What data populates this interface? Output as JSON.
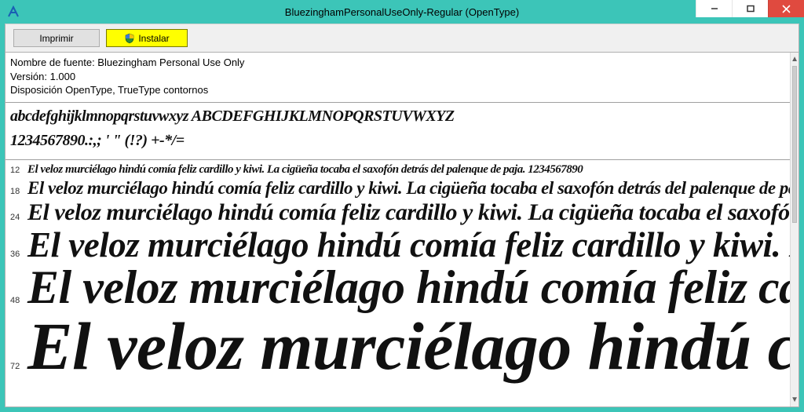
{
  "window": {
    "title": "BluezinghamPersonalUseOnly-Regular (OpenType)"
  },
  "toolbar": {
    "print_label": "Imprimir",
    "install_label": "Instalar"
  },
  "meta": {
    "font_name_line": "Nombre de fuente: Bluezingham Personal Use Only",
    "version_line": "Versión: 1.000",
    "layout_line": "Disposición OpenType, TrueType  contornos"
  },
  "glyphs": {
    "line1": "abcdefghijklmnopqrstuvwxyz ABCDEFGHIJKLMNOPQRSTUVWXYZ",
    "line2": "1234567890.:,; ' \" (!?) +-*/="
  },
  "pangram": "El veloz murciélago hindú comía feliz cardillo y kiwi. La cigüeña tocaba el saxofón detrás del palenque de paja. 1234567890",
  "sizes": {
    "s12": "12",
    "s18": "18",
    "s24": "24",
    "s36": "36",
    "s48": "48",
    "s72": "72"
  },
  "colors": {
    "chrome": "#3cc5b8",
    "close": "#e04a3f",
    "install_bg": "#ffff00"
  }
}
